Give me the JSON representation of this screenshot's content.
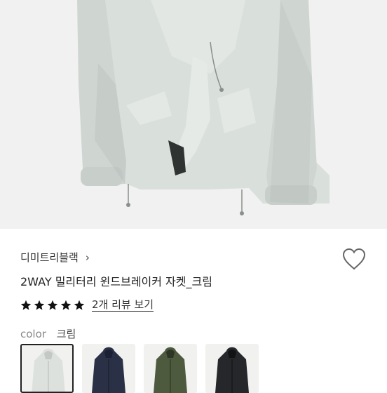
{
  "product": {
    "brand": "디미트리블랙",
    "brand_chevron": "›",
    "title": "2WAY 밀리터리 윈드브레이커 자켓_크림",
    "rating_stars": 5,
    "review_link": "2개 리뷰 보기",
    "color_label": "color",
    "color_value": "크림"
  },
  "hero_image": {
    "icon": "jacket-photo",
    "background": "#f0f1f0",
    "jacket_color": "#d9dfdb"
  },
  "swatches": [
    {
      "icon": "jacket-thumbnail-cream",
      "color": "#dde1de",
      "selected": true
    },
    {
      "icon": "jacket-thumbnail-navy",
      "color": "#2a3147",
      "selected": false
    },
    {
      "icon": "jacket-thumbnail-khaki",
      "color": "#4d5a3e",
      "selected": false
    },
    {
      "icon": "jacket-thumbnail-black",
      "color": "#26272a",
      "selected": false
    }
  ],
  "colors": {
    "star": "#111111",
    "heart_outline": "#666666",
    "selected_border": "#222222"
  }
}
